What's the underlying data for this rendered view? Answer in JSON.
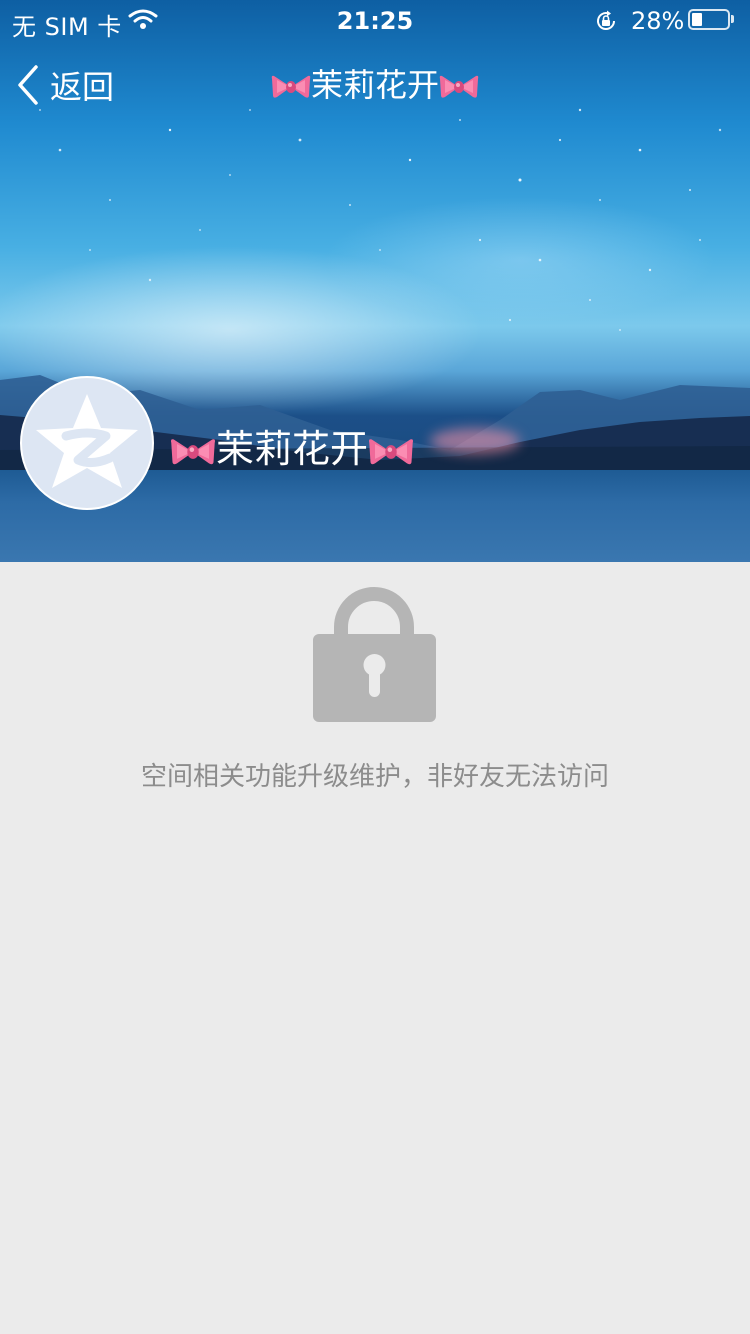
{
  "status_bar": {
    "carrier": "无 SIM 卡",
    "time": "21:25",
    "battery_percent": "28%",
    "battery_level": 0.28,
    "icons": [
      "wifi-icon",
      "rotation-lock-icon",
      "battery-icon"
    ]
  },
  "nav": {
    "back_label": "返回",
    "title": "茉莉花开"
  },
  "profile": {
    "name": "茉莉花开",
    "avatar_icon": "qzone-star-icon",
    "decoration_icon": "pink-bow-emoji"
  },
  "locked": {
    "icon": "padlock-icon",
    "message": "空间相关功能升级维护，非好友无法访问"
  },
  "colors": {
    "page_background": "#ebebeb",
    "lock_gray": "#b5b5b5",
    "message_gray": "#8c8c8c",
    "bow_pink": "#f06a9a"
  }
}
